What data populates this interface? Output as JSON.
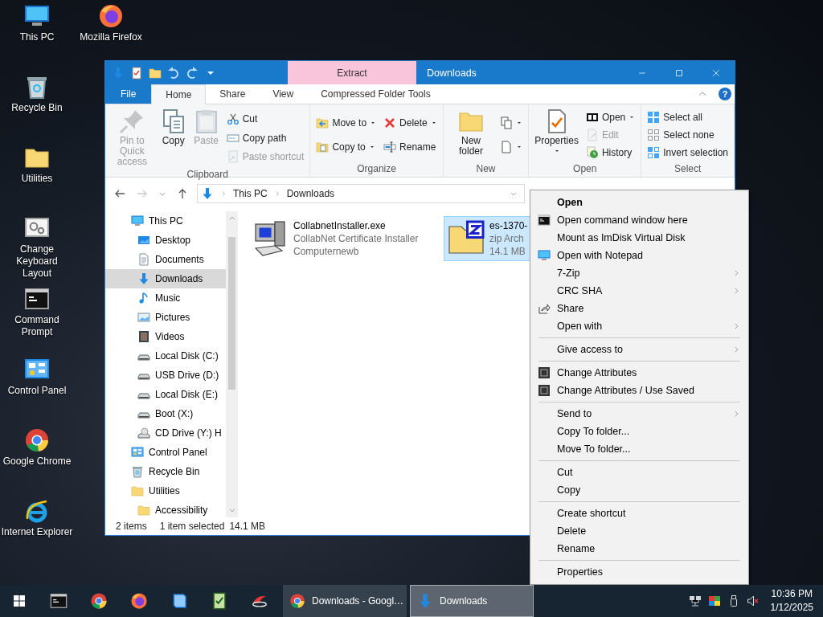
{
  "desktop": {
    "columns": [
      [
        {
          "label": "This PC",
          "kind": "monitor"
        },
        {
          "label": "Recycle Bin",
          "kind": "trash-bin"
        },
        {
          "label": "Utilities",
          "kind": "folder"
        },
        {
          "label": "Change Keyboard Layout",
          "kind": "gears-window"
        },
        {
          "label": "Command Prompt",
          "kind": "console"
        },
        {
          "label": "Control Panel",
          "kind": "control-panel"
        },
        {
          "label": "Google Chrome",
          "kind": "ball-logo"
        },
        {
          "label": "Internet Explorer",
          "kind": "e-logo"
        }
      ],
      [
        {
          "label": "Mozilla Firefox",
          "kind": "fox-logo"
        }
      ]
    ]
  },
  "explorer": {
    "title": "Downloads",
    "contextual_tab": "Extract",
    "help": "?",
    "tabs": [
      {
        "label": "File",
        "kind": "file-menu",
        "selected": false
      },
      {
        "label": "Home",
        "kind": "tab",
        "selected": true
      },
      {
        "label": "Share",
        "kind": "tab",
        "selected": false
      },
      {
        "label": "View",
        "kind": "tab",
        "selected": false
      },
      {
        "label": "Compressed Folder Tools",
        "kind": "tab",
        "selected": false
      }
    ],
    "ribbon": [
      {
        "name": "Clipboard",
        "columns": [
          {
            "kind": "large",
            "items": [
              {
                "label": "Pin to Quick access",
                "kind": "pin",
                "disabled": true,
                "dropdown": false
              }
            ]
          },
          {
            "kind": "large",
            "items": [
              {
                "label": "Copy",
                "kind": "pages",
                "disabled": false,
                "dropdown": false
              }
            ]
          },
          {
            "kind": "large",
            "items": [
              {
                "label": "Paste",
                "kind": "clipboard",
                "disabled": true,
                "dropdown": false
              }
            ]
          },
          {
            "kind": "small",
            "items": [
              {
                "label": "Cut",
                "kind": "scissors",
                "disabled": false,
                "dropdown": false
              },
              {
                "label": "Copy path",
                "kind": "path-box",
                "disabled": false,
                "dropdown": false
              },
              {
                "label": "Paste shortcut",
                "kind": "shortcut-doc",
                "disabled": true,
                "dropdown": false
              }
            ]
          }
        ]
      },
      {
        "name": "Organize",
        "columns": [
          {
            "kind": "small",
            "items": [
              {
                "label": "Move to",
                "kind": "folder-arrow",
                "disabled": false,
                "dropdown": true
              },
              {
                "label": "Copy to",
                "kind": "folder-pages",
                "disabled": false,
                "dropdown": true
              }
            ]
          },
          {
            "kind": "small",
            "items": [
              {
                "label": "Delete",
                "kind": "cross",
                "disabled": false,
                "dropdown": true
              },
              {
                "label": "Rename",
                "kind": "text-cursor",
                "disabled": false,
                "dropdown": false
              }
            ]
          }
        ]
      },
      {
        "name": "New",
        "columns": [
          {
            "kind": "large",
            "items": [
              {
                "label": "New folder",
                "kind": "folder",
                "disabled": false,
                "dropdown": false
              }
            ]
          },
          {
            "kind": "small",
            "items": [
              {
                "kind": "stacked-docs",
                "disabled": false,
                "dropdown": true
              },
              {
                "kind": "doc-corner",
                "disabled": false,
                "dropdown": true
              }
            ]
          }
        ]
      },
      {
        "name": "Open",
        "columns": [
          {
            "kind": "large",
            "items": [
              {
                "label": "Properties",
                "kind": "check-sheet",
                "disabled": false,
                "dropdown": true
              }
            ]
          },
          {
            "kind": "small",
            "items": [
              {
                "label": "Open",
                "kind": "archive-box",
                "disabled": false,
                "dropdown": true
              },
              {
                "label": "Edit",
                "kind": "pencil-doc",
                "disabled": true,
                "dropdown": false
              },
              {
                "label": "History",
                "kind": "history-clock",
                "disabled": false,
                "dropdown": false
              }
            ]
          }
        ]
      },
      {
        "name": "Select",
        "columns": [
          {
            "kind": "small",
            "items": [
              {
                "label": "Select all",
                "kind": "squares-grid",
                "disabled": false,
                "dropdown": false
              },
              {
                "label": "Select none",
                "kind": "empty-grid",
                "disabled": false,
                "dropdown": false
              },
              {
                "label": "Invert selection",
                "kind": "mixed-grid",
                "disabled": false,
                "dropdown": false
              }
            ]
          }
        ]
      }
    ],
    "address": {
      "segments": [
        "This PC",
        "Downloads"
      ]
    },
    "nav": [
      {
        "label": "This PC",
        "kind": "monitor",
        "selected": false,
        "children": [
          {
            "label": "Desktop",
            "kind": "desktop-screen",
            "selected": false
          },
          {
            "label": "Documents",
            "kind": "text-doc",
            "selected": false
          },
          {
            "label": "Downloads",
            "kind": "down-arrow",
            "selected": true
          },
          {
            "label": "Music",
            "kind": "music-note",
            "selected": false
          },
          {
            "label": "Pictures",
            "kind": "picture",
            "selected": false
          },
          {
            "label": "Videos",
            "kind": "film",
            "selected": false
          },
          {
            "label": "Local Disk (C:)",
            "kind": "drive",
            "selected": false
          },
          {
            "label": "USB Drive (D:)",
            "kind": "drive",
            "selected": false
          },
          {
            "label": "Local Disk (E:)",
            "kind": "drive",
            "selected": false
          },
          {
            "label": "Boot (X:)",
            "kind": "drive",
            "selected": false
          },
          {
            "label": "CD Drive (Y:) H",
            "kind": "disc-drive",
            "selected": false
          }
        ]
      },
      {
        "label": "Control Panel",
        "kind": "control-panel",
        "selected": false
      },
      {
        "label": "Recycle Bin",
        "kind": "trash-bin",
        "selected": false
      },
      {
        "label": "Utilities",
        "kind": "folder",
        "selected": false,
        "children": [
          {
            "label": "Accessibility",
            "kind": "folder",
            "selected": false
          }
        ]
      }
    ],
    "files": [
      {
        "name": "CollabnetInstaller.exe",
        "details": [
          "CollabNet Certificate Installer",
          "Computernewb"
        ],
        "kind": "computer",
        "selected": false
      },
      {
        "name": "es-1370-",
        "details": [
          "zip Arch",
          "14.1 MB"
        ],
        "kind": "zip-folder",
        "selected": true
      }
    ],
    "status_bar": {
      "item_count": "2 items",
      "selection": "1 item selected",
      "size": "14.1 MB"
    }
  },
  "context_menu": {
    "sections": [
      [
        {
          "label": "Open",
          "kind": "plain",
          "default": true,
          "submenu": false
        },
        {
          "label": "Open command window here",
          "kind": "console",
          "default": false,
          "submenu": false
        },
        {
          "label": "Mount as ImDisk Virtual Disk",
          "kind": "plain",
          "default": false,
          "submenu": false
        },
        {
          "label": "Open with Notepad",
          "kind": "monitor",
          "default": false,
          "submenu": false
        },
        {
          "label": "7-Zip",
          "kind": "plain",
          "default": false,
          "submenu": true
        },
        {
          "label": "CRC SHA",
          "kind": "plain",
          "default": false,
          "submenu": true
        },
        {
          "label": "Share",
          "kind": "share-arrow",
          "default": false,
          "submenu": false
        },
        {
          "label": "Open with",
          "kind": "plain",
          "default": false,
          "submenu": true
        }
      ],
      [
        {
          "label": "Give access to",
          "kind": "plain",
          "default": false,
          "submenu": true
        }
      ],
      [
        {
          "label": "Change Attributes",
          "kind": "attribute-tile",
          "default": false,
          "submenu": false
        },
        {
          "label": "Change Attributes / Use Saved",
          "kind": "attribute-tile",
          "default": false,
          "submenu": false
        }
      ],
      [
        {
          "label": "Send to",
          "kind": "plain",
          "default": false,
          "submenu": true
        },
        {
          "label": "Copy To folder...",
          "kind": "plain",
          "default": false,
          "submenu": false
        },
        {
          "label": "Move To folder...",
          "kind": "plain",
          "default": false,
          "submenu": false
        }
      ],
      [
        {
          "label": "Cut",
          "kind": "plain",
          "default": false,
          "submenu": false
        },
        {
          "label": "Copy",
          "kind": "plain",
          "default": false,
          "submenu": false
        }
      ],
      [
        {
          "label": "Create shortcut",
          "kind": "plain",
          "default": false,
          "submenu": false
        },
        {
          "label": "Delete",
          "kind": "plain",
          "default": false,
          "submenu": false
        },
        {
          "label": "Rename",
          "kind": "plain",
          "default": false,
          "submenu": false
        }
      ],
      [
        {
          "label": "Properties",
          "kind": "plain",
          "default": false,
          "submenu": false
        }
      ]
    ]
  },
  "taskbar": {
    "windows": [
      {
        "label": "Downloads - Googl…",
        "kind": "ball-logo",
        "selected": false
      },
      {
        "label": "Downloads",
        "kind": "down-arrow",
        "selected": true
      }
    ],
    "time": "10:36 PM",
    "date": "1/12/2025"
  }
}
